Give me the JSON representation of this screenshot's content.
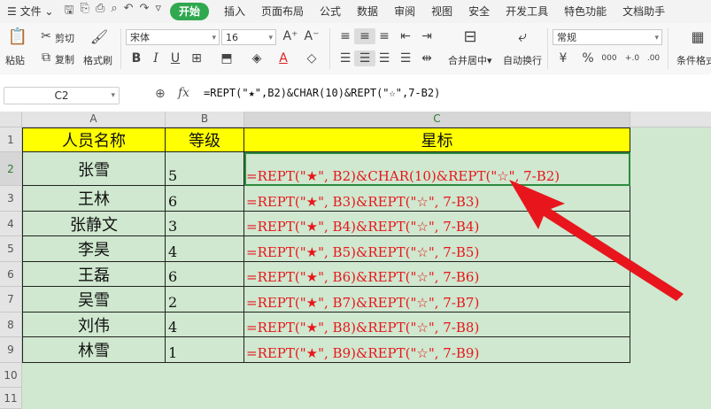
{
  "menu": {
    "file": "文件",
    "items": [
      "开始",
      "插入",
      "页面布局",
      "公式",
      "数据",
      "审阅",
      "视图",
      "安全",
      "开发工具",
      "特色功能",
      "文档助手"
    ]
  },
  "ribbon": {
    "paste": "粘贴",
    "cut": "剪切",
    "copy": "复制",
    "format_painter": "格式刷",
    "font_name": "宋体",
    "font_size": "16",
    "merge": "合并居中",
    "wrap": "自动换行",
    "number_format": "常规",
    "percent": "%",
    "thousands": "000",
    "cond_format": "条件格式"
  },
  "formula_bar": {
    "name_box": "C2",
    "fx": "fx",
    "formula": "=REPT(\"★\",B2)&CHAR(10)&REPT(\"☆\",7-B2)"
  },
  "sheet": {
    "columns": [
      "A",
      "B",
      "C"
    ],
    "rows": [
      "1",
      "2",
      "3",
      "4",
      "5",
      "6",
      "7",
      "8",
      "9",
      "10",
      "11"
    ],
    "header": {
      "name": "人员名称",
      "level": "等级",
      "star": "星标"
    },
    "data": [
      {
        "name": "张雪",
        "level": "5",
        "formula": "=REPT(\"★\", B2)&CHAR(10)&REPT(\"☆\", 7-B2)"
      },
      {
        "name": "王林",
        "level": "6",
        "formula": "=REPT(\"★\", B3)&REPT(\"☆\", 7-B3)"
      },
      {
        "name": "张静文",
        "level": "3",
        "formula": "=REPT(\"★\", B4)&REPT(\"☆\", 7-B4)"
      },
      {
        "name": "李昊",
        "level": "4",
        "formula": "=REPT(\"★\", B5)&REPT(\"☆\", 7-B5)"
      },
      {
        "name": "王磊",
        "level": "6",
        "formula": "=REPT(\"★\", B6)&REPT(\"☆\", 7-B6)"
      },
      {
        "name": "吴雪",
        "level": "2",
        "formula": "=REPT(\"★\", B7)&REPT(\"☆\", 7-B7)"
      },
      {
        "name": "刘伟",
        "level": "4",
        "formula": "=REPT(\"★\", B8)&REPT(\"☆\", 7-B8)"
      },
      {
        "name": "林雪",
        "level": "1",
        "formula": "=REPT(\"★\", B9)&REPT(\"☆\", 7-B9)"
      }
    ]
  },
  "colors": {
    "accent": "#2fa84f",
    "header_fill": "#ffff00",
    "formula_text": "#e8161c",
    "sheet_bg": "#cfe8cf",
    "arrow": "#e8161c"
  }
}
